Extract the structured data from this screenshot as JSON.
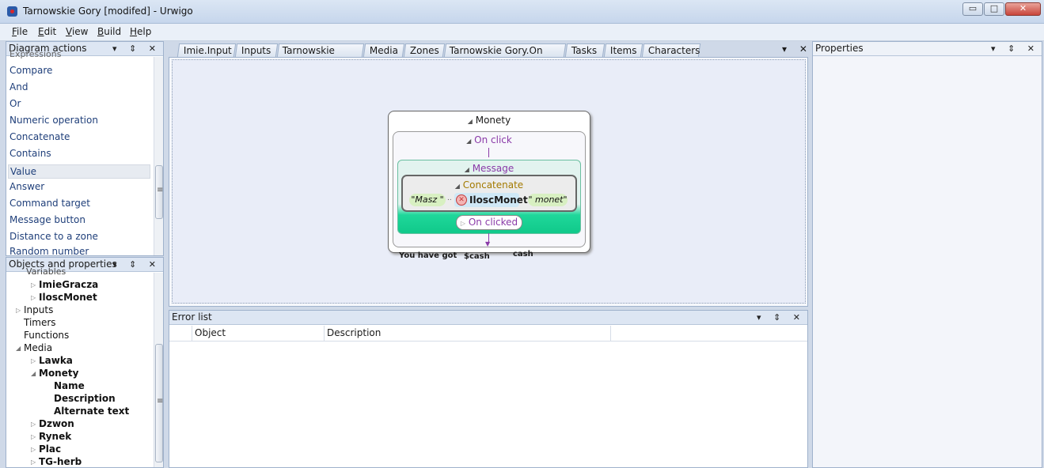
{
  "window": {
    "title": "Tarnowskie Gory [modifed] - Urwigo",
    "app_icon": "urwigo-app-icon",
    "minimize": "▭",
    "maximize": "□",
    "close": "✕"
  },
  "menu": [
    {
      "label": "File",
      "accel": "F"
    },
    {
      "label": "Edit",
      "accel": "E"
    },
    {
      "label": "View",
      "accel": "V"
    },
    {
      "label": "Build",
      "accel": "B"
    },
    {
      "label": "Help",
      "accel": "H"
    }
  ],
  "panel_icons": "▾ ⇕ ✕",
  "diagram_actions": {
    "title": "Diagram actions",
    "partial_top": "Expressions",
    "items": [
      "Compare",
      "And",
      "Or",
      "Numeric operation",
      "Concatenate",
      "Contains",
      "Value",
      "Answer",
      "Command target",
      "Message button",
      "Distance to a zone"
    ],
    "partial_bottom": "Random number",
    "selected": "Value"
  },
  "objects": {
    "title": "Objects and properties",
    "partial_top": "Variables",
    "items": [
      {
        "label": "ImieGracza",
        "bold": true,
        "expand": "▷"
      },
      {
        "label": "IloscMonet",
        "bold": true,
        "expand": "▷"
      },
      {
        "label": "Inputs",
        "bold": false,
        "expand": "▷"
      },
      {
        "label": "Timers",
        "bold": false,
        "expand": ""
      },
      {
        "label": "Functions",
        "bold": false,
        "expand": ""
      },
      {
        "label": "Media",
        "bold": false,
        "expand": "◢"
      },
      {
        "label": "Lawka",
        "bold": true,
        "expand": "▷"
      },
      {
        "label": "Monety",
        "bold": true,
        "expand": "◢"
      },
      {
        "label": "Name",
        "bold": true,
        "expand": ""
      },
      {
        "label": "Description",
        "bold": true,
        "expand": ""
      },
      {
        "label": "Alternate text",
        "bold": true,
        "expand": ""
      },
      {
        "label": "Dzwon",
        "bold": true,
        "expand": "▷"
      },
      {
        "label": "Rynek",
        "bold": true,
        "expand": "▷"
      },
      {
        "label": "Plac",
        "bold": true,
        "expand": "▷"
      },
      {
        "label": "TG-herb",
        "bold": true,
        "expand": "▷"
      }
    ]
  },
  "tabs": [
    "Imie.Input",
    "Inputs",
    "Tarnowskie Gory",
    "Media",
    "Zones",
    "Tarnowskie Gory.On start",
    "Tasks",
    "Items",
    "Characters"
  ],
  "tab_icons": "▾ ✕",
  "diagram": {
    "root": "Monety",
    "event": "On click",
    "action": "Message",
    "concat": "Concatenate",
    "str1": "\"Masz \"",
    "sep": "..",
    "var": "IloscMonet",
    "str2": "\" monet\"",
    "button": "On clicked",
    "note1": "You have got",
    "note2": "$cash",
    "note3": "cash"
  },
  "error_list": {
    "title": "Error list",
    "columns": [
      "Object",
      "Description"
    ]
  },
  "properties": {
    "title": "Properties"
  }
}
